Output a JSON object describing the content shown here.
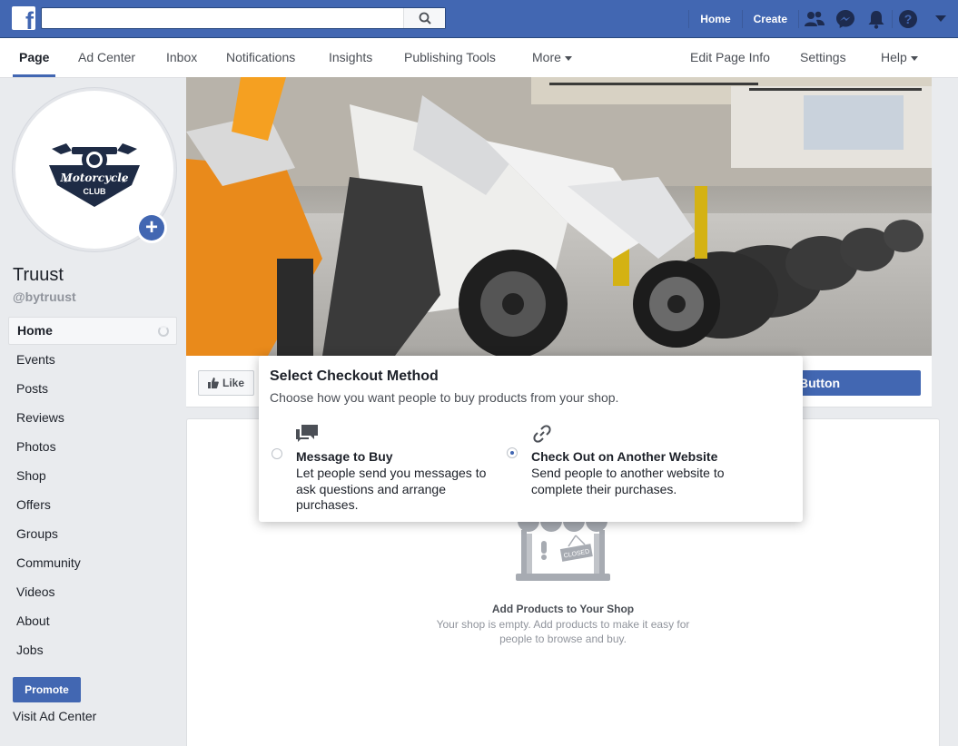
{
  "topbar": {
    "search_placeholder": "",
    "home_label": "Home",
    "create_label": "Create"
  },
  "page_nav": {
    "tabs": [
      "Page",
      "Ad Center",
      "Inbox",
      "Notifications",
      "Insights",
      "Publishing Tools",
      "More"
    ],
    "right": [
      "Edit Page Info",
      "Settings",
      "Help"
    ]
  },
  "profile": {
    "logo_text_1": "Motorcycle",
    "logo_text_2": "CLUB",
    "name": "Truust",
    "handle": "@bytruust"
  },
  "side_menu": [
    "Home",
    "Events",
    "Posts",
    "Reviews",
    "Photos",
    "Shop",
    "Offers",
    "Groups",
    "Community",
    "Videos",
    "About",
    "Jobs"
  ],
  "promote_label": "Promote",
  "visit_ad_center": "Visit Ad Center",
  "action_bar": {
    "like_label": "Like",
    "cta_label": "Button"
  },
  "popover": {
    "title": "Select Checkout Method",
    "subtitle": "Choose how you want people to buy products from your shop.",
    "options": [
      {
        "title": "Message to Buy",
        "desc": "Let people send you messages to ask questions and arrange purchases.",
        "icon": "chat-bubbles-icon",
        "selected": false
      },
      {
        "title": "Check Out on Another Website",
        "desc": "Send people to another website to complete their purchases.",
        "icon": "link-icon",
        "selected": true
      }
    ]
  },
  "shop": {
    "sign_text": "CLOSED",
    "title": "Add Products to Your Shop",
    "desc": "Your shop is empty. Add products to make it easy for people to browse and buy."
  },
  "colors": {
    "brand": "#4267b2",
    "background": "#e9ebee"
  }
}
